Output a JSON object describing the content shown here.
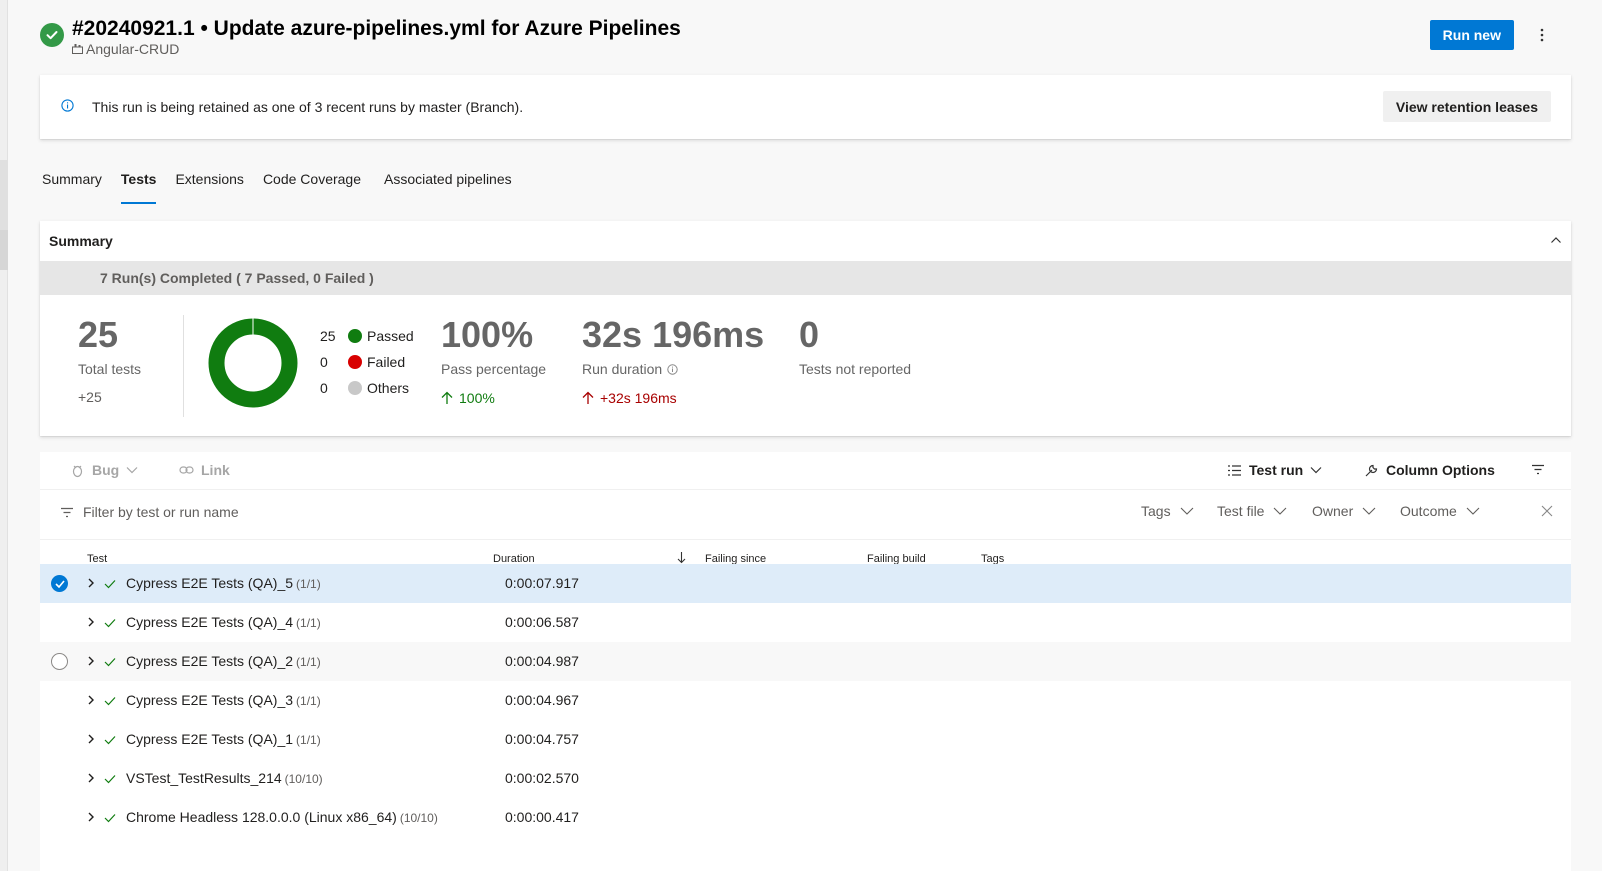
{
  "header": {
    "title": "#20240921.1 • Update azure-pipelines.yml for Azure Pipelines",
    "pipeline": "Angular-CRUD",
    "run_new_label": "Run new"
  },
  "banner": {
    "message": "This run is being retained as one of 3 recent runs by master (Branch).",
    "button_label": "View retention leases"
  },
  "tabs": [
    {
      "label": "Summary",
      "active": false
    },
    {
      "label": "Tests",
      "active": true
    },
    {
      "label": "Extensions",
      "active": false
    },
    {
      "label": "Code Coverage",
      "active": false
    },
    {
      "label": "Associated pipelines",
      "active": false
    }
  ],
  "summary": {
    "heading": "Summary",
    "runs_completed": "7 Run(s) Completed ( 7 Passed, 0 Failed )",
    "total_tests": {
      "value": "25",
      "label": "Total tests",
      "delta": "+25"
    },
    "outcomes": [
      {
        "count": "25",
        "label": "Passed",
        "color": "#107c10"
      },
      {
        "count": "0",
        "label": "Failed",
        "color": "#d80000"
      },
      {
        "count": "0",
        "label": "Others",
        "color": "#c8c8c8"
      }
    ],
    "pass_percentage": {
      "value": "100%",
      "label": "Pass percentage",
      "delta": "100%",
      "delta_color": "#107c10"
    },
    "run_duration": {
      "value": "32s 196ms",
      "label": "Run duration",
      "delta": "+32s 196ms",
      "delta_color": "#a80000"
    },
    "not_reported": {
      "value": "0",
      "label": "Tests not reported"
    }
  },
  "toolbar": {
    "bug_label": "Bug",
    "link_label": "Link",
    "group_by_label": "Test run",
    "column_options_label": "Column Options"
  },
  "filters": {
    "search_placeholder": "Filter by test or run name",
    "tags": "Tags",
    "test_file": "Test file",
    "owner": "Owner",
    "outcome": "Outcome"
  },
  "columns": {
    "test": "Test",
    "duration": "Duration",
    "failing_since": "Failing since",
    "failing_build": "Failing build",
    "tags": "Tags"
  },
  "rows": [
    {
      "name": "Cypress E2E Tests (QA)_5",
      "count": "(1/1)",
      "duration": "0:00:07.917",
      "state": "selected"
    },
    {
      "name": "Cypress E2E Tests (QA)_4",
      "count": "(1/1)",
      "duration": "0:00:06.587",
      "state": "normal"
    },
    {
      "name": "Cypress E2E Tests (QA)_2",
      "count": "(1/1)",
      "duration": "0:00:04.987",
      "state": "hover"
    },
    {
      "name": "Cypress E2E Tests (QA)_3",
      "count": "(1/1)",
      "duration": "0:00:04.967",
      "state": "normal"
    },
    {
      "name": "Cypress E2E Tests (QA)_1",
      "count": "(1/1)",
      "duration": "0:00:04.757",
      "state": "normal"
    },
    {
      "name": "VSTest_TestResults_214",
      "count": "(10/10)",
      "duration": "0:00:02.570",
      "state": "normal"
    },
    {
      "name": "Chrome Headless 128.0.0.0 (Linux x86_64)",
      "count": "(10/10)",
      "duration": "0:00:00.417",
      "state": "normal"
    }
  ]
}
